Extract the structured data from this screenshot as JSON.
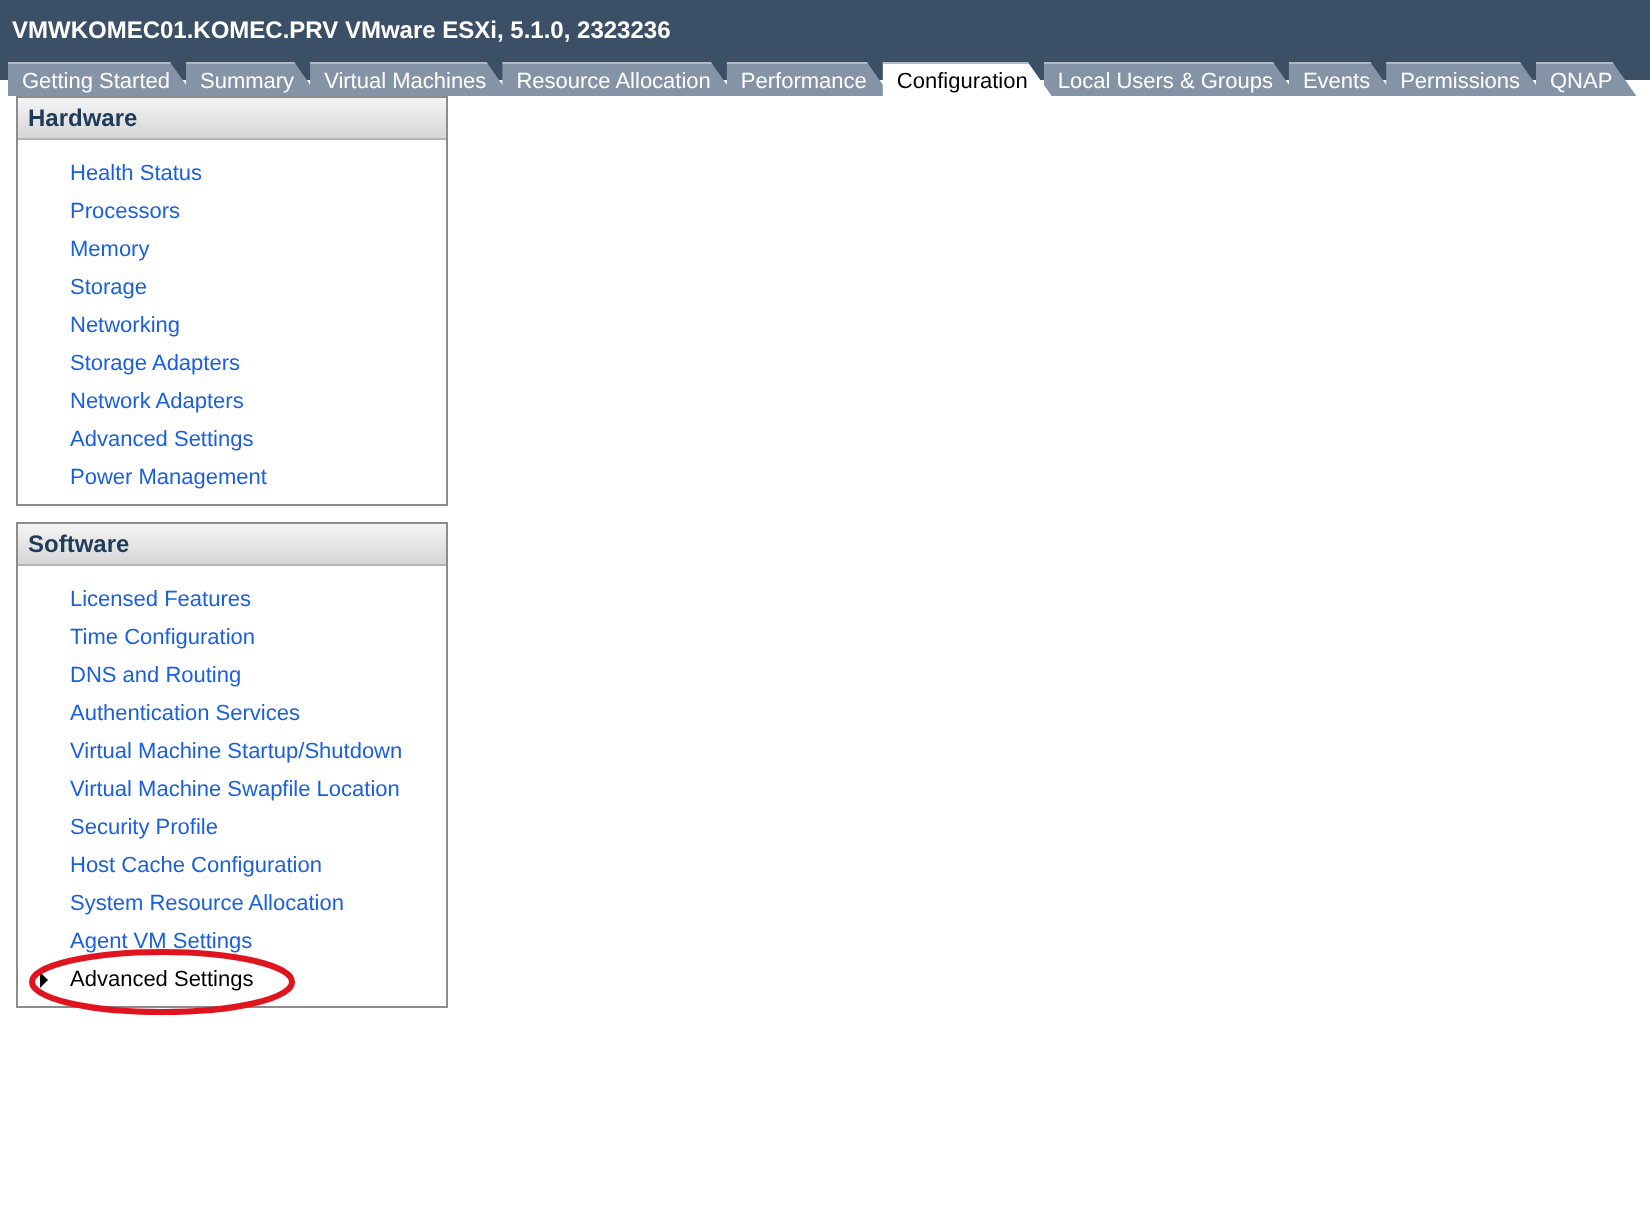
{
  "window": {
    "title": "VMWKOMEC01.KOMEC.PRV VMware ESXi, 5.1.0, 2323236"
  },
  "tabs": [
    {
      "label": "Getting Started",
      "selected": false
    },
    {
      "label": "Summary",
      "selected": false
    },
    {
      "label": "Virtual Machines",
      "selected": false
    },
    {
      "label": "Resource Allocation",
      "selected": false
    },
    {
      "label": "Performance",
      "selected": false
    },
    {
      "label": "Configuration",
      "selected": true
    },
    {
      "label": "Local Users & Groups",
      "selected": false
    },
    {
      "label": "Events",
      "selected": false
    },
    {
      "label": "Permissions",
      "selected": false
    },
    {
      "label": "QNAP",
      "selected": false
    }
  ],
  "sections": [
    {
      "title": "Hardware",
      "items": [
        {
          "label": "Health Status",
          "selected": false
        },
        {
          "label": "Processors",
          "selected": false
        },
        {
          "label": "Memory",
          "selected": false
        },
        {
          "label": "Storage",
          "selected": false
        },
        {
          "label": "Networking",
          "selected": false
        },
        {
          "label": "Storage Adapters",
          "selected": false
        },
        {
          "label": "Network Adapters",
          "selected": false
        },
        {
          "label": "Advanced Settings",
          "selected": false
        },
        {
          "label": "Power Management",
          "selected": false
        }
      ]
    },
    {
      "title": "Software",
      "items": [
        {
          "label": "Licensed Features",
          "selected": false
        },
        {
          "label": "Time Configuration",
          "selected": false
        },
        {
          "label": "DNS and Routing",
          "selected": false
        },
        {
          "label": "Authentication Services",
          "selected": false
        },
        {
          "label": "Virtual Machine Startup/Shutdown",
          "selected": false
        },
        {
          "label": "Virtual Machine Swapfile Location",
          "selected": false
        },
        {
          "label": "Security Profile",
          "selected": false
        },
        {
          "label": "Host Cache Configuration",
          "selected": false
        },
        {
          "label": "System Resource Allocation",
          "selected": false
        },
        {
          "label": "Agent VM Settings",
          "selected": false
        },
        {
          "label": "Advanced Settings",
          "selected": true,
          "circled": true
        }
      ]
    }
  ]
}
